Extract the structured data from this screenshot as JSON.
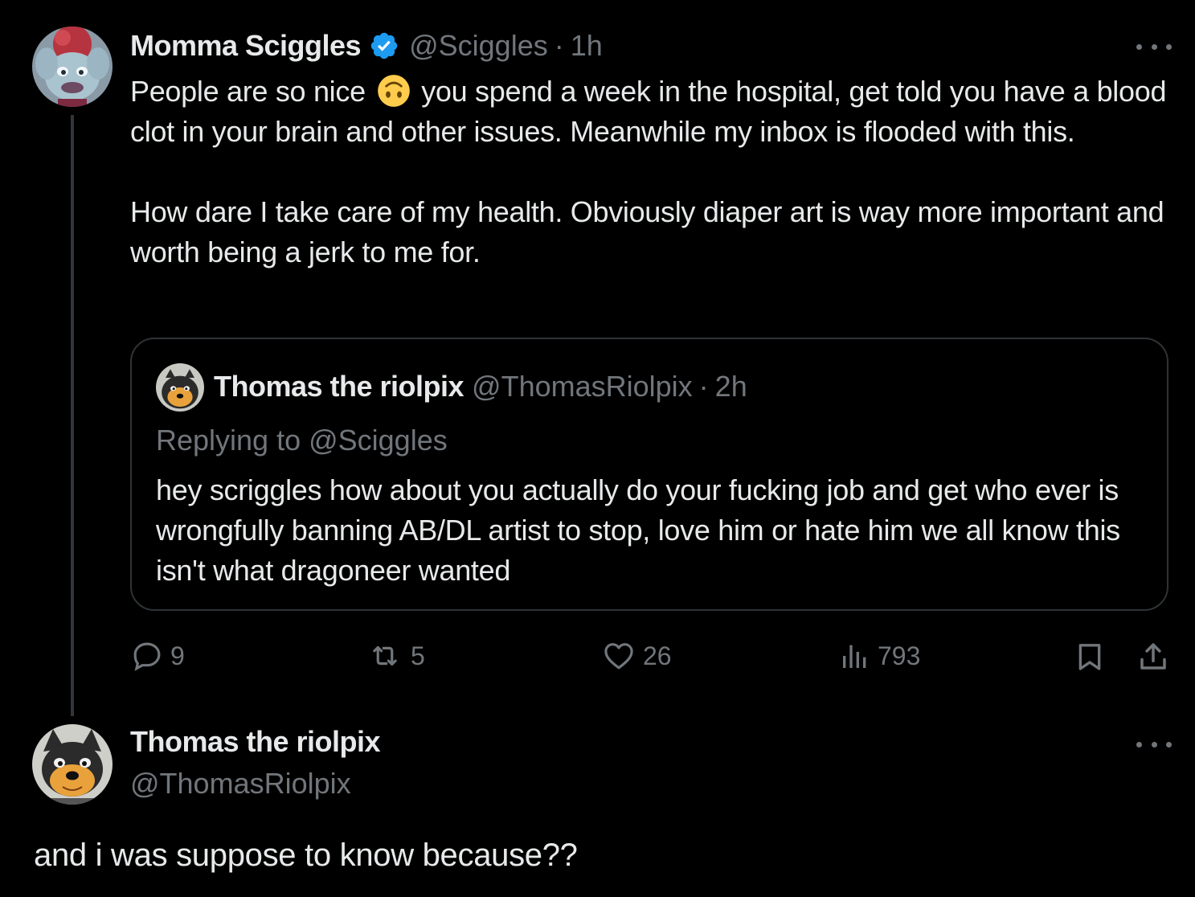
{
  "main_tweet": {
    "display_name": "Momma Sciggles",
    "handle": "@Sciggles",
    "separator": "·",
    "time": "1h",
    "text_part1": "People are so nice",
    "text_part2": " you spend a week in the hospital, get told you have a blood clot in your brain and other issues. Meanwhile my inbox is flooded with this.",
    "text_para2": "How dare I take care of my health. Obviously diaper art is way more important and worth being a jerk to me for.",
    "emoji": "upside-down-face-emoji"
  },
  "quoted_tweet": {
    "display_name": "Thomas the riolpix",
    "handle": "@ThomasRiolpix",
    "separator": "·",
    "time": "2h",
    "replying_to": "Replying to @Sciggles",
    "text": "hey scriggles how about you actually do your fucking job and get who ever is wrongfully banning AB/DL artist to stop, love him or hate him we all know this isn't what dragoneer wanted"
  },
  "actions": {
    "replies": "9",
    "reposts": "5",
    "likes": "26",
    "views": "793"
  },
  "reply_tweet": {
    "display_name": "Thomas the riolpix",
    "handle": "@ThomasRiolpix",
    "text": "and i was suppose to know because??"
  },
  "colors": {
    "background": "#000000",
    "text_primary": "#e7e9ea",
    "text_secondary": "#71767b",
    "border": "#2f3336",
    "verified_blue": "#1d9bf0"
  }
}
